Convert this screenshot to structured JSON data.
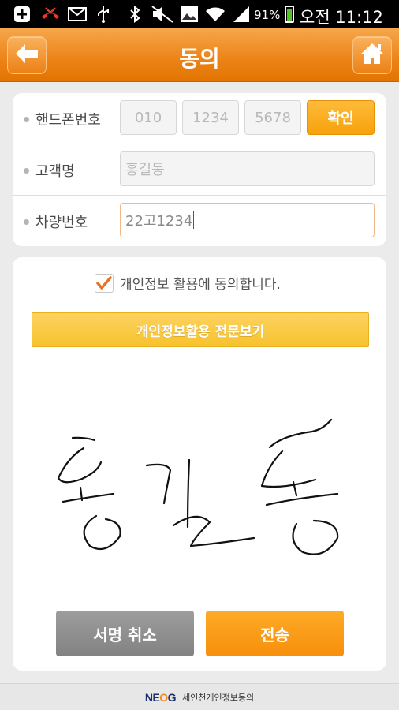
{
  "status_bar": {
    "battery": "91%",
    "time": "오전 11:12",
    "icons": [
      "add-icon",
      "missed-call-icon",
      "mail-icon",
      "usb-icon",
      "bluetooth-icon",
      "mute-icon",
      "image-icon",
      "wifi-icon",
      "signal-icon",
      "battery-icon"
    ]
  },
  "header": {
    "title": "동의",
    "back_icon": "back-arrow-icon",
    "home_icon": "home-icon"
  },
  "form": {
    "phone": {
      "label": "핸드폰번호",
      "part1_placeholder": "010",
      "part2_placeholder": "1234",
      "part3_placeholder": "5678",
      "confirm_label": "확인"
    },
    "name": {
      "label": "고객명",
      "placeholder": "홍길동"
    },
    "car": {
      "label": "차량번호",
      "value": "22고1234"
    }
  },
  "agreement": {
    "checked": true,
    "text": "개인정보 활용에 동의합니다.",
    "view_button": "개인정보활용 전문보기"
  },
  "signature": {
    "content": "홍길동"
  },
  "actions": {
    "cancel_label": "서명 취소",
    "send_label": "전송"
  },
  "footer": {
    "logo_prefix": "NE",
    "logo_accent": "O",
    "logo_suffix": "G",
    "text": "세인천개인정보동의"
  },
  "colors": {
    "header_orange": "#ec8317",
    "confirm_button": "#f7a10c",
    "view_button": "#f7c22e",
    "cancel_button": "#8f8f8f",
    "send_button": "#f78f0b",
    "checkmark": "#e8742a"
  }
}
